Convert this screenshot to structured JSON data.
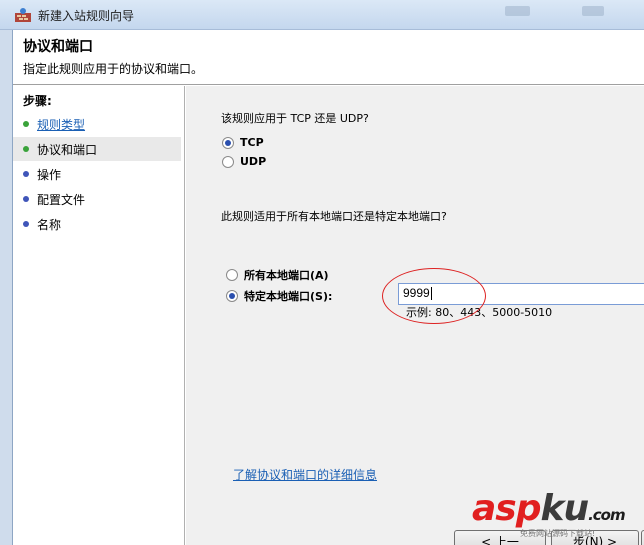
{
  "window": {
    "title": "新建入站规则向导"
  },
  "header": {
    "title": "协议和端口",
    "subtitle": "指定此规则应用于的协议和端口。"
  },
  "steps": {
    "title": "步骤:",
    "items": [
      {
        "label": "规则类型",
        "dot": "#3aa33a"
      },
      {
        "label": "协议和端口",
        "dot": "#3aa33a"
      },
      {
        "label": "操作",
        "dot": "#3f55b9"
      },
      {
        "label": "配置文件",
        "dot": "#3f55b9"
      },
      {
        "label": "名称",
        "dot": "#3f55b9"
      }
    ]
  },
  "main": {
    "protocol_question": "该规则应用于 TCP 还是 UDP?",
    "protocol_options": [
      {
        "label": "TCP",
        "selected": true
      },
      {
        "label": "UDP",
        "selected": false
      }
    ],
    "port_question": "此规则适用于所有本地端口还是特定本地端口?",
    "port_options": [
      {
        "label": "所有本地端口(A)",
        "selected": false
      },
      {
        "label": "特定本地端口(S):",
        "selected": true
      }
    ],
    "port_value": "9999",
    "port_example": "示例: 80、443、5000-5010",
    "learn_more": "了解协议和端口的详细信息"
  },
  "buttons": {
    "prev": "< 上一",
    "next": "步(N) >"
  },
  "watermark": {
    "brand_a": "asp",
    "brand_b": "ku",
    "brand_c": ".com",
    "sub": "免费网站源码下载站!"
  },
  "colors": {
    "accent_link": "#1a5fb4",
    "annotation_red": "#d22222"
  }
}
